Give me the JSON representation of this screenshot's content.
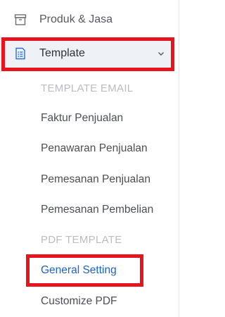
{
  "sidebar": {
    "produk_label": "Produk & Jasa",
    "template_label": "Template",
    "template_email_heading": "TEMPLATE EMAIL",
    "email_items": [
      "Faktur Penjualan",
      "Penawaran Penjualan",
      "Pemesanan Penjualan",
      "Pemesanan Pembelian"
    ],
    "pdf_template_heading": "PDF TEMPLATE",
    "pdf_items": [
      "General Setting",
      "Customize PDF"
    ]
  },
  "icons": {
    "produk": "box-icon",
    "template": "document-list-icon",
    "expand": "chevron-down-icon"
  },
  "colors": {
    "active_link": "#1d62c9",
    "highlight": "#e8141d",
    "selected_bg": "#eef1f6"
  }
}
